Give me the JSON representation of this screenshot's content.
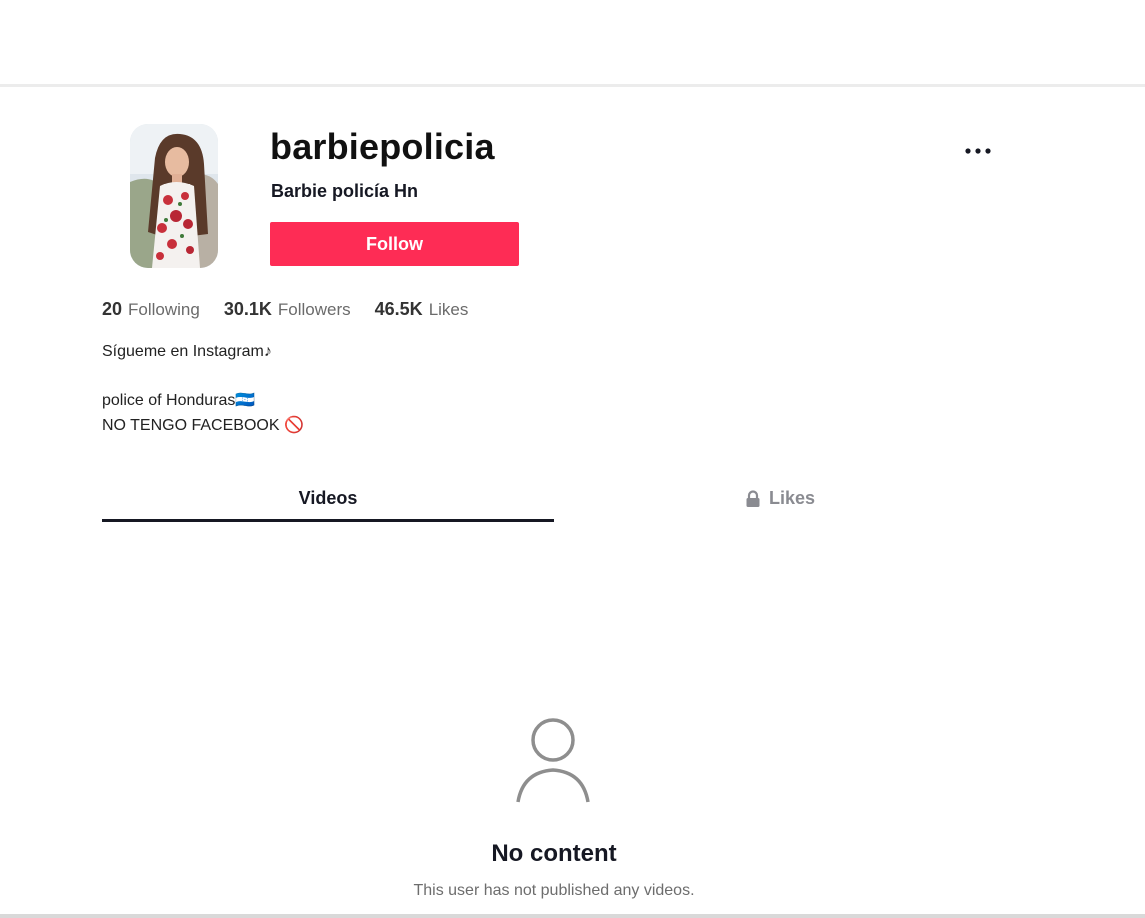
{
  "profile": {
    "username": "barbiepolicia",
    "nickname": "Barbie policía Hn",
    "follow_label": "Follow",
    "more_label": "More options"
  },
  "stats": [
    {
      "value": "20",
      "label": "Following"
    },
    {
      "value": "30.1K",
      "label": "Followers"
    },
    {
      "value": "46.5K",
      "label": "Likes"
    }
  ],
  "bio": {
    "line1": "Sígueme en Instagram♪",
    "line2": "police of Honduras🇭🇳",
    "line3": "NO TENGO FACEBOOK 🚫"
  },
  "tabs": {
    "videos": "Videos",
    "likes": "Likes"
  },
  "empty_state": {
    "title": "No content",
    "description": "This user has not published any videos."
  },
  "colors": {
    "accent": "#fe2c55",
    "text": "#161823",
    "muted": "#8a8b91"
  },
  "icons": {
    "more": "ellipsis-icon",
    "lock": "lock-icon",
    "empty": "user-outline-icon"
  }
}
